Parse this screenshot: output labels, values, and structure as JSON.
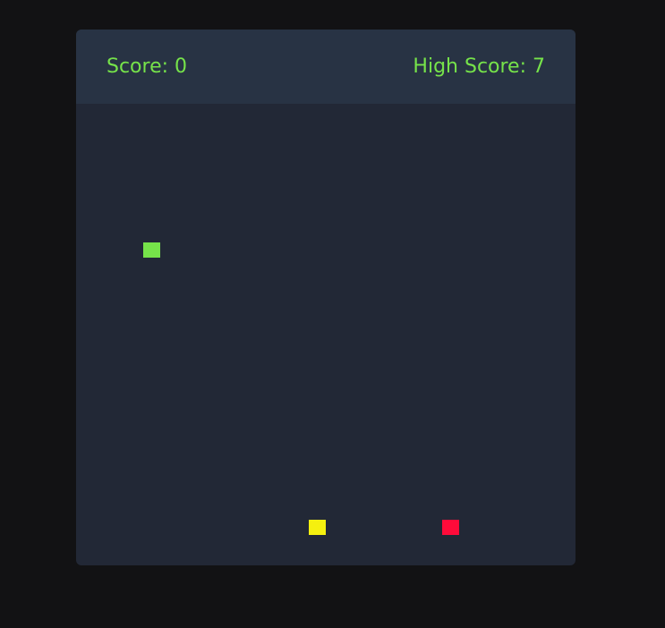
{
  "score": {
    "label": "Score: 0",
    "value": 0
  },
  "high_score": {
    "label": "High Score: 7",
    "value": 7
  },
  "colors": {
    "page_background": "#121214",
    "panel_background": "#222836",
    "scorebar_background": "#283344",
    "text_accent": "#76e34a",
    "snake": "#76e34a",
    "food": "#f5f00f",
    "hazard": "#ff0b3a"
  }
}
